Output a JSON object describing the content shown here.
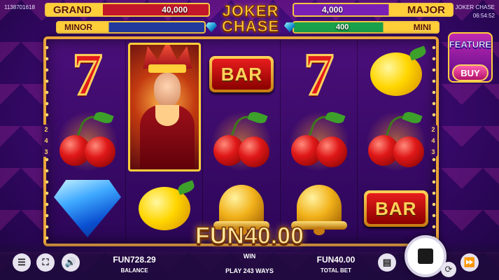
{
  "session": {
    "id": "1138701618",
    "game_name": "JOKER CHASE",
    "time": "06:54:52"
  },
  "jackpots": {
    "grand": {
      "label": "GRAND",
      "value": "40,000"
    },
    "minor": {
      "label": "MINOR",
      "value": ""
    },
    "major": {
      "label": "MAJOR",
      "value": "4,000"
    },
    "mini": {
      "label": "MINI",
      "value": "400"
    }
  },
  "logo": {
    "line1": "JOKER",
    "line2": "CHASE"
  },
  "reels": [
    [
      "seven",
      "cherry",
      "diamond"
    ],
    [
      "joker",
      "joker",
      "lemon"
    ],
    [
      "bar",
      "cherry",
      "bell"
    ],
    [
      "seven",
      "cherry",
      "bell"
    ],
    [
      "lemon",
      "cherry",
      "bar"
    ]
  ],
  "symbols": {
    "bar_text": "BAR"
  },
  "ways_indicator": [
    "2",
    "4",
    "3"
  ],
  "win": {
    "amount": "FUN40.00",
    "label": "WIN",
    "ways": "PLAY 243 WAYS"
  },
  "footer": {
    "balance_value": "FUN728.29",
    "balance_label": "BALANCE",
    "bet_value": "FUN40.00",
    "bet_label": "TOTAL BET"
  },
  "feature": {
    "label": "FEATURE",
    "buy_label": "BUY"
  },
  "icons": {
    "menu": "☰",
    "fullscreen": "⛶",
    "sound": "🔊",
    "bet": "▤",
    "autoplay": "⟳",
    "turbo": "⏩"
  },
  "colors": {
    "gold": "#ffcf3a",
    "frame": "#e9a43a",
    "bg": "#3d0a73"
  }
}
